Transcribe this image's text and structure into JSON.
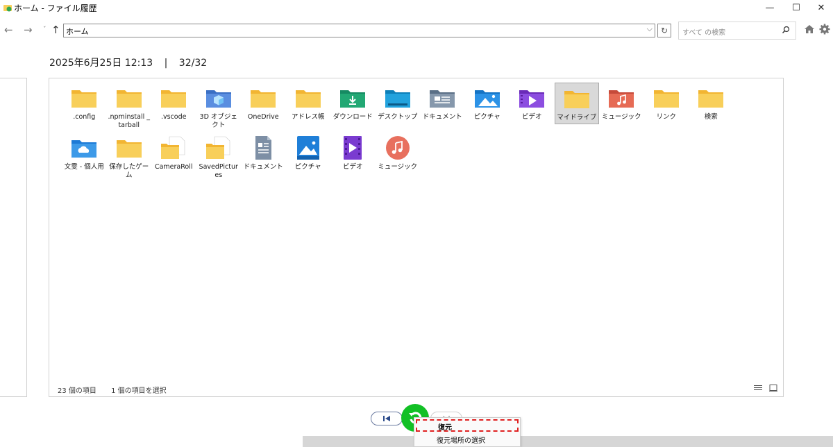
{
  "window": {
    "title": "ホーム - ファイル履歴",
    "minimize": "—",
    "maximize": "☐",
    "close": "✕"
  },
  "nav": {
    "address": "ホーム",
    "search_placeholder": "すべて の検索"
  },
  "backup": {
    "datetime": "2025年6月25日 12:13",
    "separator": "|",
    "version": "32/32"
  },
  "items": [
    {
      "label": ".config",
      "icon": "folder-icon"
    },
    {
      "label": ".npminstall _tarball",
      "icon": "folder-icon"
    },
    {
      "label": ".vscode",
      "icon": "folder-icon"
    },
    {
      "label": "3D オブジェクト",
      "icon": "3d-objects-icon"
    },
    {
      "label": "OneDrive",
      "icon": "folder-icon"
    },
    {
      "label": "アドレス帳",
      "icon": "folder-icon"
    },
    {
      "label": "ダウンロード",
      "icon": "downloads-icon"
    },
    {
      "label": "デスクトップ",
      "icon": "desktop-icon"
    },
    {
      "label": "ドキュメント",
      "icon": "documents-icon"
    },
    {
      "label": "ピクチャ",
      "icon": "pictures-icon"
    },
    {
      "label": "ビデオ",
      "icon": "videos-icon"
    },
    {
      "label": "マイドライブ",
      "icon": "folder-icon"
    },
    {
      "label": "ミュージック",
      "icon": "music-icon"
    },
    {
      "label": "リンク",
      "icon": "folder-icon"
    },
    {
      "label": "検索",
      "icon": "folder-icon"
    },
    {
      "label": "文雯 - 個人用",
      "icon": "onedrive-folder-icon"
    },
    {
      "label": "保存したゲーム",
      "icon": "folder-icon"
    },
    {
      "label": "CameraRoll",
      "icon": "library-folder-icon"
    },
    {
      "label": "SavedPictures",
      "icon": "library-folder-icon"
    },
    {
      "label": "ドキュメント",
      "icon": "documents-library-icon"
    },
    {
      "label": "ピクチャ",
      "icon": "pictures-library-icon"
    },
    {
      "label": "ビデオ",
      "icon": "videos-library-icon"
    },
    {
      "label": "ミュージック",
      "icon": "music-library-icon"
    }
  ],
  "selected_item": "マイドライブ",
  "status": {
    "count": "23 個の項目",
    "selected": "1 個の項目を選択"
  },
  "context_menu": {
    "restore": "復元",
    "restore_to": "復元場所の選択"
  },
  "colors": {
    "folder": "#f8cf5a",
    "restore_green": "#12c025",
    "highlight_red": "#e02020"
  }
}
